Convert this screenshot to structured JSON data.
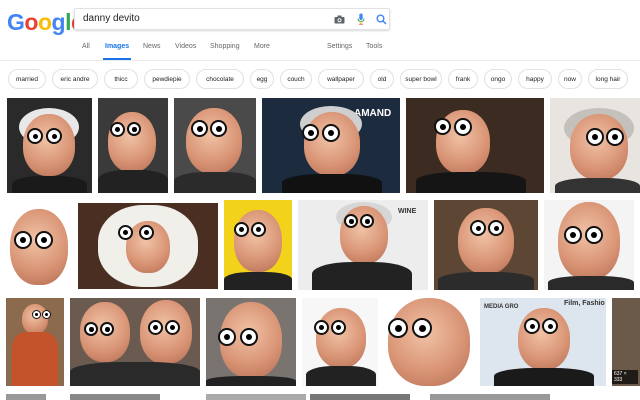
{
  "logo": {
    "letters": [
      "G",
      "o",
      "o",
      "g",
      "l",
      "e"
    ],
    "colors": [
      "#4285F4",
      "#EA4335",
      "#FBBC05",
      "#4285F4",
      "#34A853",
      "#EA4335"
    ]
  },
  "search": {
    "query": "danny devito",
    "camera_icon": "camera-icon",
    "mic_icon": "mic-icon",
    "search_icon": "search-icon"
  },
  "tabs": [
    "All",
    "Images",
    "News",
    "Videos",
    "Shopping",
    "More",
    "Settings",
    "Tools"
  ],
  "active_tab": "Images",
  "chips": [
    "married",
    "eric andre",
    "thicc",
    "pewdiepie",
    "chocolate",
    "egg",
    "couch",
    "wallpaper",
    "old",
    "super bowl",
    "frank",
    "ongo",
    "happy",
    "now",
    "long hair"
  ],
  "overlays": {
    "tile4_text": "AMAND",
    "tile10_text": "WINE",
    "tile17_text": "Film, Fashio",
    "tile17_sub": "MEDIA GRO",
    "tile17_size": "637 × 333"
  },
  "colors": {
    "accent": "#1a73e8",
    "chip_border": "#dfe1e5"
  }
}
